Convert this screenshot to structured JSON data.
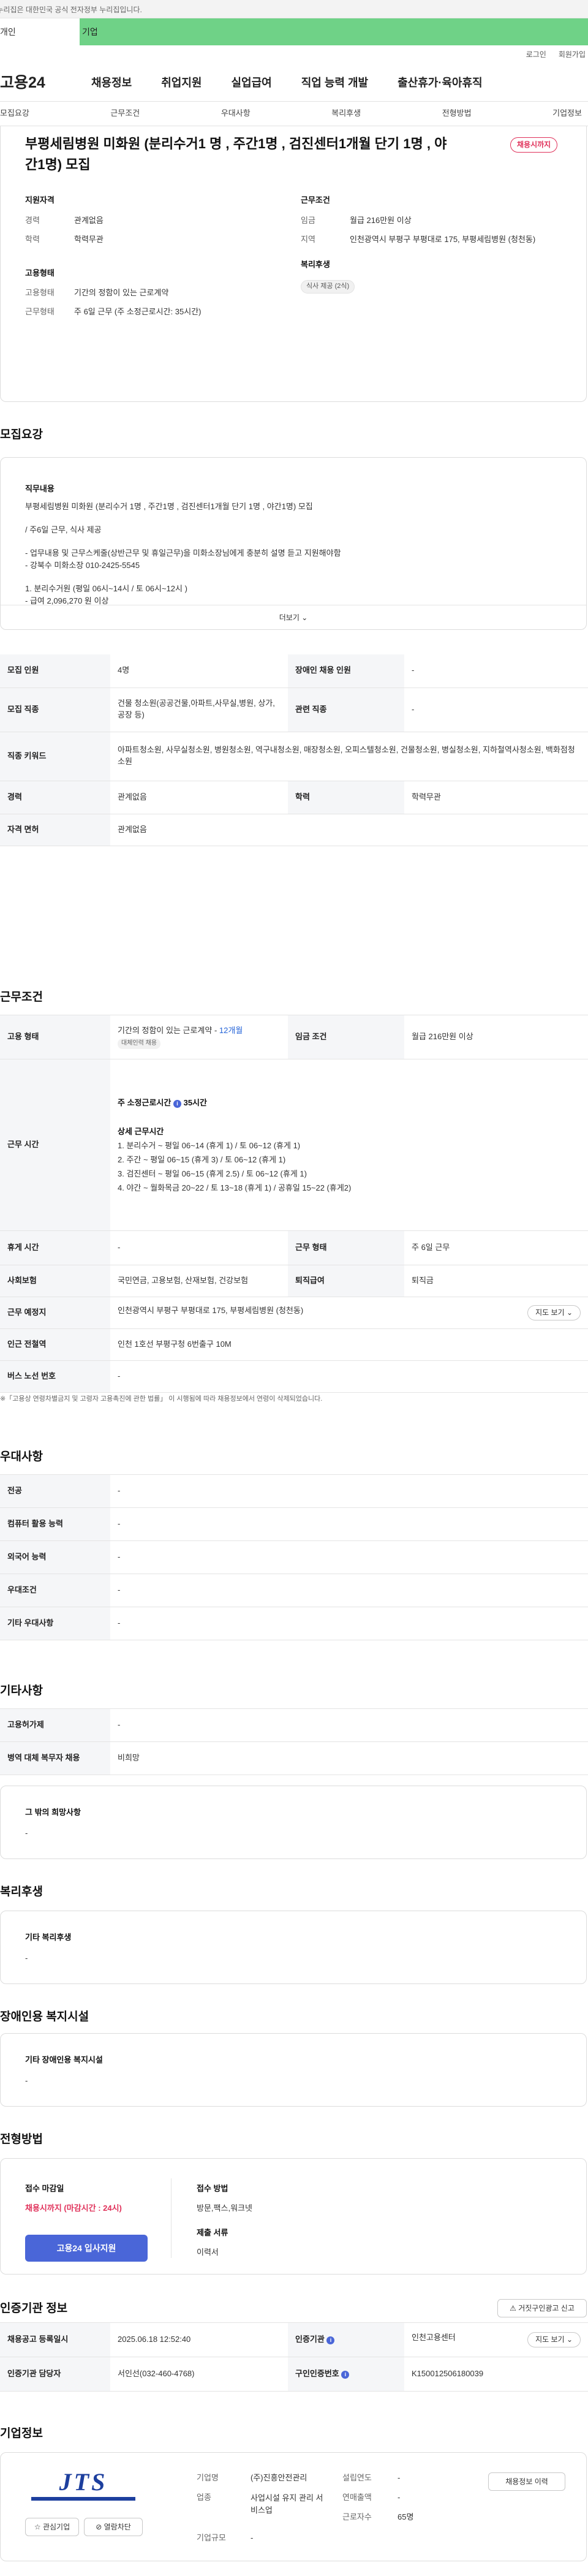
{
  "gov_notice": "이 누리집은 대한민국 공식 전자정부 누리집입니다.",
  "top_tabs": {
    "personal": "개인",
    "company": "기업"
  },
  "util": {
    "login": "로그인",
    "signup": "회원가입"
  },
  "gnb": {
    "logo": "고용24",
    "menus": [
      "채용정보",
      "취업지원",
      "실업급여",
      "직업 능력 개발",
      "출산휴가·육아휴직"
    ]
  },
  "subnav": [
    "모집요강",
    "근무조건",
    "우대사항",
    "복리후생",
    "전형방법",
    "기업정보"
  ],
  "job": {
    "title": "부평세림병원 미화원 (분리수거1 명 , 주간1명 , 검진센터1개월 단기 1명 , 야간1명) 모집",
    "badge": "채용시까지",
    "qual_title": "지원자격",
    "career_label": "경력",
    "career_value": "관계없음",
    "edu_label": "학력",
    "edu_value": "학력무관",
    "cond_title": "근무조건",
    "wage_label": "임금",
    "wage_value": "월급 216만원 이상",
    "region_label": "지역",
    "region_value": "인천광역시 부평구 부평대로 175, 부평세림병원 (청천동)",
    "emp_title": "고용형태",
    "emp_label": "고용형태",
    "emp_value": "기간의 정함이 있는 근로계약",
    "work_label": "근무형태",
    "work_value": "주 6일 근무 (주 소정근로시간: 35시간)",
    "welfare_title": "복리후생",
    "welfare_chip": "식사 제공 (2식)"
  },
  "recruit": {
    "section_title": "모집요강",
    "duty_title": "직무내용",
    "duty_lines": [
      "부평세림병원 미화원 (분리수거 1명 , 주간1명 , 검진센터1개월 단기 1명 , 야간1명) 모집",
      "/ 주6일 근무, 식사 제공",
      "- 업무내용 및 근무스케줄(상반근무 및 휴일근무)을 미화소장님에게 충분히 설명 듣고 지원해야함",
      "- 강북수 미화소장 010-2425-5545",
      "1. 분리수거원 (평일 06시~14시 / 토 06시~12시 )",
      "- 급여 2,096,270 원 이상"
    ],
    "more_label": "더보기",
    "rows": {
      "count_label": "모집 인원",
      "count_value": "4명",
      "disabled_label": "장애인 채용 인원",
      "disabled_value": "-",
      "job_label": "모집 직종",
      "job_value": "건물 청소원(공공건물,아파트,사무실,병원, 상가,공장 등)",
      "related_label": "관련 직종",
      "related_value": "-",
      "keyword_label": "직종 키워드",
      "keyword_value": "아파트청소원, 사무실청소원, 병원청소원, 역구내청소원, 매장청소원, 오피스텔청소원, 건물청소원, 병실청소원, 지하철역사청소원, 백화점청소원",
      "career_label": "경력",
      "career_value": "관계없음",
      "edu_label": "학력",
      "edu_value": "학력무관",
      "license_label": "자격 면허",
      "license_value": "관계없음"
    }
  },
  "workcond": {
    "section_title": "근무조건",
    "emp_label": "고용 형태",
    "emp_value": "기간의 정함이 있는 근로계약 -",
    "emp_months": "12개월",
    "emp_tag": "대체인력 채용",
    "wage_label": "임금 조건",
    "wage_value": "월급 216만원 이상",
    "time_label": "근무 시간",
    "time_total_prefix": "주 소정근로시간",
    "time_total_value": "35시간",
    "time_detail_title": "상세 근무시간",
    "time_lines": [
      "1. 분리수거 ~ 평일 06~14 (휴게 1) / 토 06~12 (휴게 1)",
      "2. 주간 ~ 평일 06~15 (휴게 3) / 토 06~12 (휴게 1)",
      "3. 검진센터 ~ 평일 06~15 (휴게 2.5) / 토 06~12 (휴게 1)",
      "4. 야간 ~ 월화목금 20~22 / 토 13~18 (휴게 1) / 공휴일 15~22 (휴게2)"
    ],
    "rest_label": "휴게 시간",
    "rest_value": "-",
    "type_label": "근무 형태",
    "type_value": "주 6일 근무",
    "ins_label": "사회보험",
    "ins_value": "국민연금, 고용보험, 산재보험, 건강보험",
    "retire_label": "퇴직급여",
    "retire_value": "퇴직금",
    "place_label": "근무 예정지",
    "place_value": "인천광역시 부평구 부평대로 175, 부평세림병원 (청천동)",
    "map_btn": "지도 보기",
    "subway_label": "인근 전철역",
    "subway_value": "인천 1호선 부평구청 6번출구 10M",
    "bus_label": "버스 노선 번호",
    "bus_value": "-",
    "note": "※「고용상 연령차별금지 및 고령자 고용촉진에 관한 법률」 이 시행됨에 따라 채용정보에서 연령이 삭제되었습니다."
  },
  "pref": {
    "section_title": "우대사항",
    "rows": [
      {
        "label": "전공",
        "value": "-"
      },
      {
        "label": "컴퓨터 활용 능력",
        "value": "-"
      },
      {
        "label": "외국어 능력",
        "value": "-"
      },
      {
        "label": "우대조건",
        "value": "-"
      },
      {
        "label": "기타 우대사항",
        "value": "-"
      }
    ]
  },
  "etc": {
    "section_title": "기타사항",
    "rows": [
      {
        "label": "고용허가제",
        "value": "-"
      },
      {
        "label": "병역 대체 복무자 채용",
        "value": "비희망"
      }
    ],
    "other_title": "그 밖의 희망사항",
    "other_value": "-"
  },
  "welfare": {
    "section_title": "복리후생",
    "box_title": "기타 복리후생",
    "box_value": "-"
  },
  "disabled": {
    "section_title": "장애인용 복지시설",
    "box_title": "기타 장애인용 복지시설",
    "box_value": "-"
  },
  "screening": {
    "section_title": "전형방법",
    "deadline_label": "접수 마감일",
    "deadline_value": "채용시까지 (마감시간 : 24시)",
    "apply_btn": "고용24 입사지원",
    "method_label": "접수 방법",
    "method_value": "방문,팩스,워크넷",
    "docs_label": "제출 서류",
    "docs_value": "이력서"
  },
  "auth": {
    "section_title": "인증기관 정보",
    "report_btn": "거짓구인광고 신고",
    "reg_label": "채용공고 등록일시",
    "reg_value": "2025.06.18 12:52:40",
    "org_label": "인증기관",
    "org_value": "인천고용센터",
    "map_btn": "지도 보기",
    "mgr_label": "인증기관 담당자",
    "mgr_value": "서인선(032-460-4768)",
    "num_label": "구인인증번호",
    "num_value": "K150012506180039"
  },
  "company": {
    "section_title": "기업정보",
    "logo_text": "JTS",
    "fav_btn": "관심기업",
    "hide_btn": "열람차단",
    "hire_btn": "채용정보 이력",
    "name_label": "기업명",
    "name_value": "(주)진흥안전관리",
    "biz_label": "업종",
    "biz_value": "사업시설 유지 관리 서비스업",
    "scale_label": "기업규모",
    "scale_value": "-",
    "year_label": "설립연도",
    "year_value": "-",
    "sales_label": "연매출액",
    "sales_value": "-",
    "emp_label": "근로자수",
    "emp_value": "65명"
  },
  "colors": {
    "green": "#6fd287",
    "accent_red": "#e0315a",
    "primary_blue": "#4a66d8",
    "link_blue": "#2463d8"
  }
}
